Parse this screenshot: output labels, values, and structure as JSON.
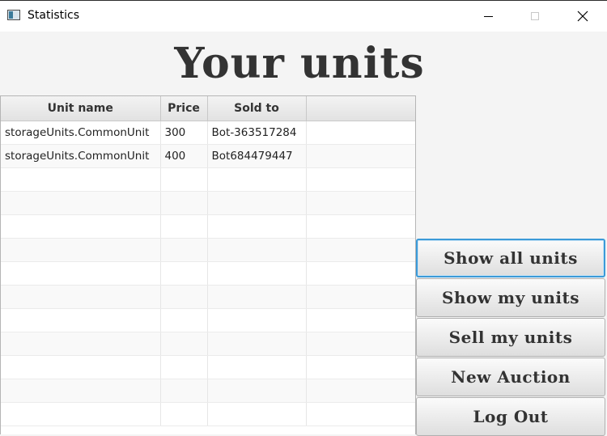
{
  "window": {
    "title": "Statistics"
  },
  "heading": "Your units",
  "table": {
    "columns": [
      "Unit name",
      "Price",
      "Sold to",
      ""
    ],
    "rows": [
      [
        "storageUnits.CommonUnit",
        "300",
        "Bot-363517284",
        ""
      ],
      [
        "storageUnits.CommonUnit",
        "400",
        "Bot684479447",
        ""
      ]
    ]
  },
  "buttons": {
    "show_all": "Show all units",
    "show_my": "Show my units",
    "sell_my": "Sell my units",
    "new_auction": "New Auction",
    "log_out": "Log Out"
  }
}
